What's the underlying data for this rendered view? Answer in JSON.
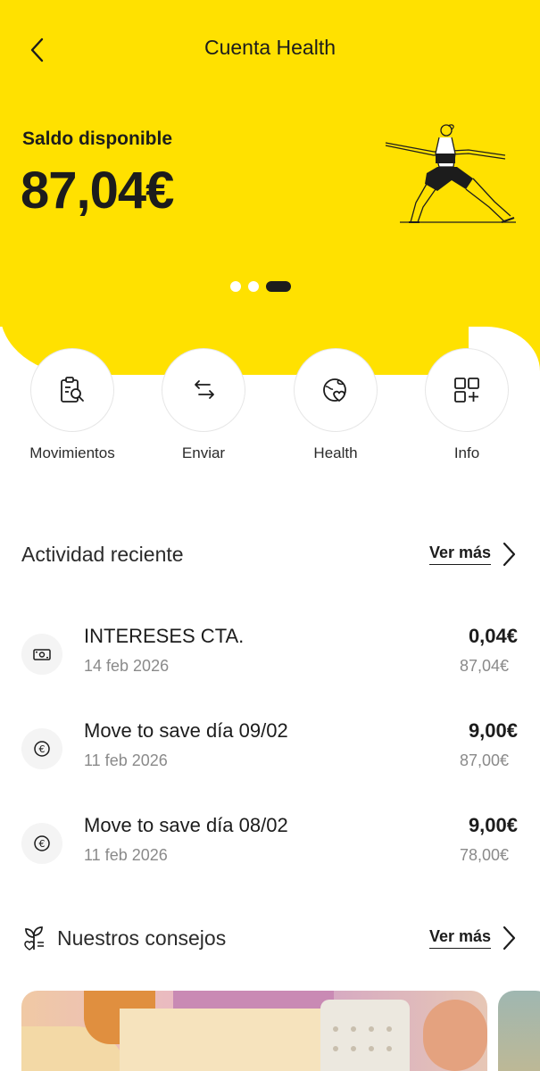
{
  "header": {
    "title": "Cuenta Health",
    "back_icon": "chevron-left-icon"
  },
  "balance": {
    "label": "Saldo disponible",
    "value": "87,04€",
    "illustration": "yoga-woman-illustration"
  },
  "carousel": {
    "pages": 3,
    "active_index": 2
  },
  "actions": [
    {
      "label": "Movimientos",
      "icon": "clipboard-search-icon"
    },
    {
      "label": "Enviar",
      "icon": "transfer-arrows-icon"
    },
    {
      "label": "Health",
      "icon": "heart-globe-icon"
    },
    {
      "label": "Info",
      "icon": "grid-plus-icon"
    }
  ],
  "recent": {
    "title": "Actividad reciente",
    "more_label": "Ver más",
    "items": [
      {
        "name": "INTERESES CTA.",
        "date": "14 feb 2026",
        "amount": "0,04€",
        "balance": "87,04€",
        "icon": "cash-icon"
      },
      {
        "name": "Move to save día 09/02",
        "date": "11 feb 2026",
        "amount": "9,00€",
        "balance": "87,00€",
        "icon": "euro-icon"
      },
      {
        "name": "Move to save día 08/02",
        "date": "11 feb 2026",
        "amount": "9,00€",
        "balance": "78,00€",
        "icon": "euro-icon"
      }
    ]
  },
  "tips": {
    "title": "Nuestros consejos",
    "more_label": "Ver más",
    "icon": "plant-heart-icon"
  },
  "colors": {
    "brand_yellow": "#ffe100",
    "text_dark": "#1c1c1c",
    "text_muted": "#8a8a8a"
  }
}
